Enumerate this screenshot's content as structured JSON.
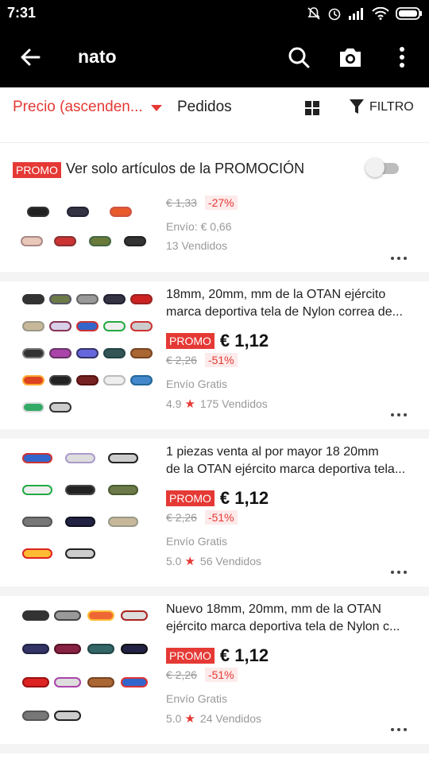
{
  "status_bar": {
    "time": "7:31"
  },
  "header": {
    "query": "nato"
  },
  "sort_bar": {
    "price_sort": "Precio (ascenden...",
    "orders": "Pedidos",
    "filter": "FILTRO"
  },
  "promo_row": {
    "badge": "PROMO",
    "label": "Ver solo artículos de la PROMOCIÓN",
    "enabled": false
  },
  "products": [
    {
      "old_price": "€ 1,33",
      "discount": "-27%",
      "shipping": "Envío: € 0,66",
      "sold": "13 Vendidos"
    },
    {
      "title_line1": "18mm, 20mm, mm de la OTAN ejército",
      "title_line2": "marca deportiva tela de Nylon correa de...",
      "promo": "PROMO",
      "price": "€ 1,12",
      "old_price": "€ 2,26",
      "discount": "-51%",
      "shipping": "Envío Gratis",
      "rating": "4.9",
      "sold": "175 Vendidos"
    },
    {
      "title_line1": "1 piezas venta al por mayor 18 20mm",
      "title_line2": "de la OTAN ejército marca deportiva tela...",
      "promo": "PROMO",
      "price": "€ 1,12",
      "old_price": "€ 2,26",
      "discount": "-51%",
      "shipping": "Envío Gratis",
      "rating": "5.0",
      "sold": "56 Vendidos"
    },
    {
      "title_line1": "Nuevo 18mm, 20mm, mm de la OTAN",
      "title_line2": "ejército marca deportiva tela de Nylon c...",
      "promo": "PROMO",
      "price": "€ 1,12",
      "old_price": "€ 2,26",
      "discount": "-51%",
      "shipping": "Envío Gratis",
      "rating": "5.0",
      "sold": "24 Vendidos"
    }
  ],
  "icons": {
    "status": [
      "mute-icon",
      "alarm-icon",
      "signal-icon",
      "wifi-icon",
      "battery-icon"
    ],
    "header": [
      "back-arrow-icon",
      "search-icon",
      "camera-icon",
      "more-vert-icon"
    ]
  },
  "colors": {
    "accent": "#e53935",
    "header_bg": "#000000",
    "text": "#222222",
    "muted": "#999999"
  }
}
